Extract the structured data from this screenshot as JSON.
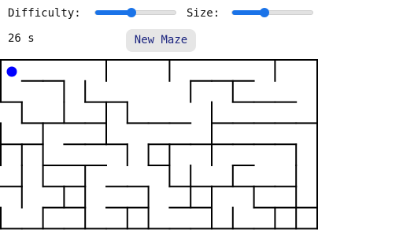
{
  "controls": {
    "difficulty_label": "Difficulty:",
    "difficulty_value": 0.45,
    "size_label": "Size:",
    "size_value": 0.4
  },
  "status": {
    "timer": "26 s"
  },
  "buttons": {
    "new_maze_label": "New Maze"
  },
  "colors": {
    "accent": "#1a73e8",
    "player": "#0000ff",
    "wall": "#000000"
  },
  "maze": {
    "cols": 15,
    "player_cell": [
      0,
      0
    ],
    "walls_h": [
      [
        0,
        0
      ],
      [
        1,
        0
      ],
      [
        2,
        0
      ],
      [
        3,
        0
      ],
      [
        4,
        0
      ],
      [
        5,
        0
      ],
      [
        6,
        0
      ],
      [
        7,
        0
      ],
      [
        8,
        0
      ],
      [
        9,
        0
      ],
      [
        10,
        0
      ],
      [
        11,
        0
      ],
      [
        12,
        0
      ],
      [
        13,
        0
      ],
      [
        14,
        0
      ],
      [
        1,
        1
      ],
      [
        2,
        1
      ],
      [
        9,
        1
      ],
      [
        10,
        1
      ],
      [
        11,
        1
      ],
      [
        0,
        2
      ],
      [
        4,
        2
      ],
      [
        5,
        2
      ],
      [
        11,
        2
      ],
      [
        12,
        2
      ],
      [
        13,
        2
      ],
      [
        1,
        3
      ],
      [
        2,
        3
      ],
      [
        3,
        3
      ],
      [
        4,
        3
      ],
      [
        6,
        3
      ],
      [
        7,
        3
      ],
      [
        8,
        3
      ],
      [
        10,
        3
      ],
      [
        11,
        3
      ],
      [
        12,
        3
      ],
      [
        13,
        3
      ],
      [
        14,
        3
      ],
      [
        0,
        4
      ],
      [
        1,
        4
      ],
      [
        3,
        4
      ],
      [
        4,
        4
      ],
      [
        5,
        4
      ],
      [
        7,
        4
      ],
      [
        8,
        4
      ],
      [
        9,
        4
      ],
      [
        10,
        4
      ],
      [
        11,
        4
      ],
      [
        12,
        4
      ],
      [
        13,
        4
      ],
      [
        2,
        5
      ],
      [
        3,
        5
      ],
      [
        4,
        5
      ],
      [
        7,
        5
      ],
      [
        11,
        5
      ],
      [
        0,
        6
      ],
      [
        2,
        6
      ],
      [
        3,
        6
      ],
      [
        5,
        6
      ],
      [
        6,
        6
      ],
      [
        8,
        6
      ],
      [
        9,
        6
      ],
      [
        10,
        6
      ],
      [
        11,
        6
      ],
      [
        12,
        6
      ],
      [
        13,
        6
      ],
      [
        2,
        7
      ],
      [
        3,
        7
      ],
      [
        5,
        7
      ],
      [
        6,
        7
      ],
      [
        8,
        7
      ],
      [
        9,
        7
      ],
      [
        12,
        7
      ],
      [
        13,
        7
      ],
      [
        14,
        7
      ],
      [
        0,
        8
      ],
      [
        1,
        8
      ],
      [
        2,
        8
      ],
      [
        3,
        8
      ],
      [
        4,
        8
      ],
      [
        5,
        8
      ],
      [
        6,
        8
      ],
      [
        7,
        8
      ],
      [
        8,
        8
      ],
      [
        9,
        8
      ],
      [
        10,
        8
      ],
      [
        11,
        8
      ],
      [
        12,
        8
      ],
      [
        13,
        8
      ],
      [
        14,
        8
      ]
    ],
    "walls_v": [
      [
        0,
        0
      ],
      [
        15,
        0
      ],
      [
        5,
        0
      ],
      [
        8,
        0
      ],
      [
        13,
        0
      ],
      [
        0,
        1
      ],
      [
        3,
        1
      ],
      [
        4,
        1
      ],
      [
        9,
        1
      ],
      [
        11,
        1
      ],
      [
        15,
        1
      ],
      [
        1,
        2
      ],
      [
        3,
        2
      ],
      [
        5,
        2
      ],
      [
        6,
        2
      ],
      [
        10,
        2
      ],
      [
        15,
        2
      ],
      [
        0,
        3
      ],
      [
        2,
        3
      ],
      [
        5,
        3
      ],
      [
        10,
        3
      ],
      [
        15,
        3
      ],
      [
        0,
        4
      ],
      [
        1,
        4
      ],
      [
        2,
        4
      ],
      [
        6,
        4
      ],
      [
        7,
        4
      ],
      [
        8,
        4
      ],
      [
        10,
        4
      ],
      [
        14,
        4
      ],
      [
        15,
        4
      ],
      [
        1,
        5
      ],
      [
        2,
        5
      ],
      [
        4,
        5
      ],
      [
        8,
        5
      ],
      [
        9,
        5
      ],
      [
        11,
        5
      ],
      [
        14,
        5
      ],
      [
        15,
        5
      ],
      [
        1,
        6
      ],
      [
        3,
        6
      ],
      [
        4,
        6
      ],
      [
        7,
        6
      ],
      [
        9,
        6
      ],
      [
        10,
        6
      ],
      [
        12,
        6
      ],
      [
        14,
        6
      ],
      [
        15,
        6
      ],
      [
        0,
        7
      ],
      [
        2,
        7
      ],
      [
        4,
        7
      ],
      [
        6,
        7
      ],
      [
        7,
        7
      ],
      [
        10,
        7
      ],
      [
        11,
        7
      ],
      [
        13,
        7
      ],
      [
        14,
        7
      ],
      [
        15,
        7
      ]
    ]
  }
}
